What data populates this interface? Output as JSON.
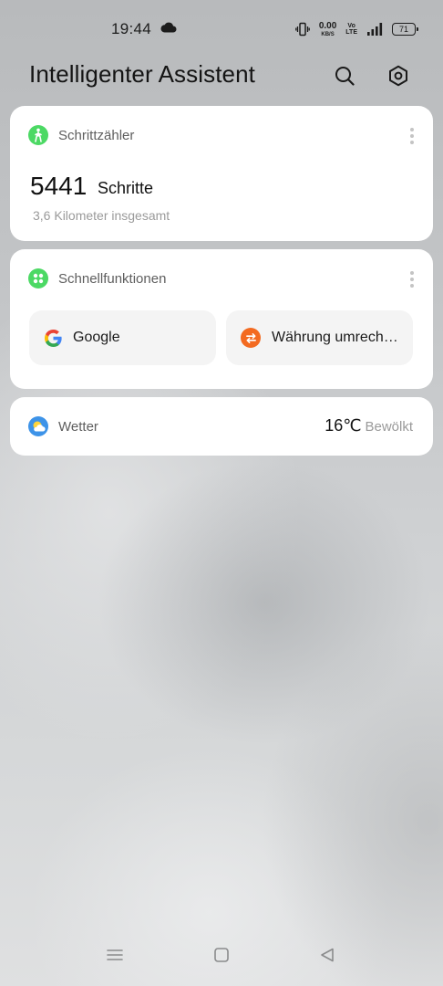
{
  "status_bar": {
    "time": "19:44",
    "net_speed_value": "0.00",
    "net_speed_unit": "KB/S",
    "volte_top": "Vo",
    "volte_bottom": "LTE",
    "battery": "71",
    "icons": [
      "cloud-icon",
      "vibrate-icon",
      "signal-icon",
      "battery-icon"
    ]
  },
  "header": {
    "title": "Intelligenter Assistent",
    "icons": [
      "search-icon",
      "settings-icon"
    ]
  },
  "step_counter": {
    "title": "Schrittzähler",
    "steps": "5441",
    "steps_unit": "Schritte",
    "distance": "3,6 Kilometer insgesamt",
    "icon": "walking-person-icon",
    "icon_color": "#4cd964"
  },
  "quick_functions": {
    "title": "Schnellfunktionen",
    "icon": "grid-dots-icon",
    "icon_color": "#4cd964",
    "items": [
      {
        "label": "Google",
        "icon": "google-icon"
      },
      {
        "label": "Währung umrech…",
        "icon": "currency-exchange-icon",
        "icon_color": "#f36a20"
      }
    ]
  },
  "weather": {
    "title": "Wetter",
    "icon": "partly-cloudy-icon",
    "temperature": "16℃",
    "condition": "Bewölkt"
  },
  "nav_bar": {
    "icons": [
      "menu-icon",
      "home-icon",
      "back-icon"
    ]
  }
}
